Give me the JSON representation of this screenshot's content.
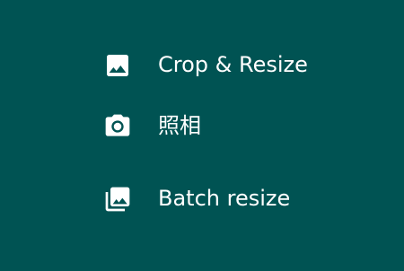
{
  "theme": {
    "background": "#005353",
    "foreground": "#ffffff"
  },
  "menu": {
    "items": [
      {
        "label": "Crop & Resize",
        "icon": "image-icon"
      },
      {
        "label": "照相",
        "icon": "camera-icon"
      },
      {
        "label": "Batch resize",
        "icon": "photo-library-icon"
      }
    ]
  }
}
